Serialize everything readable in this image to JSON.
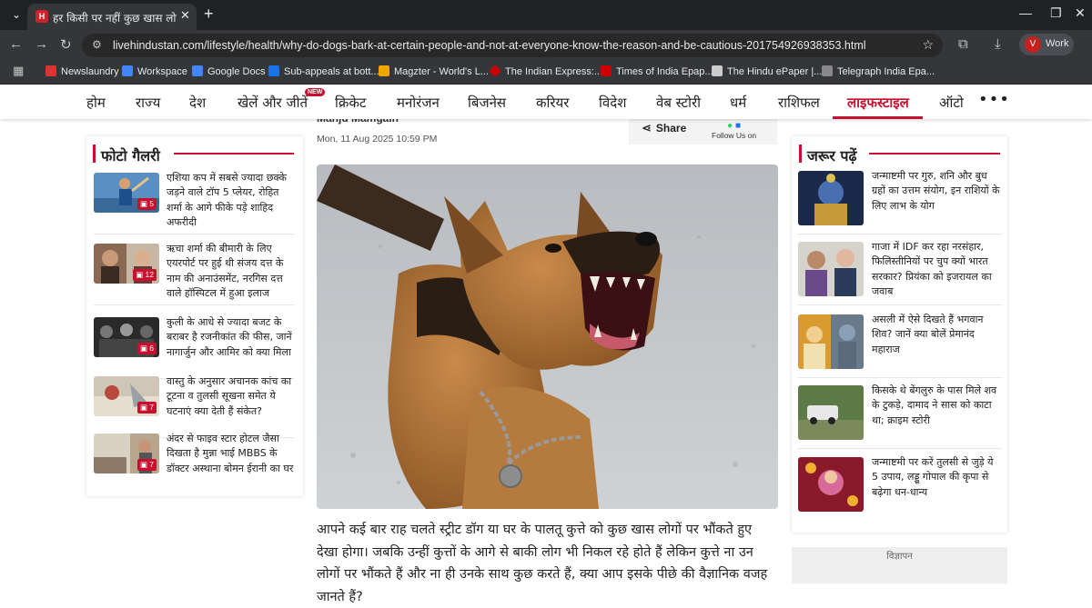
{
  "browser": {
    "tab_title": "हर किसी पर नहीं कुछ खास लोगों पर",
    "tab_favicon_letter": "H",
    "url": "livehindustan.com/lifestyle/health/why-do-dogs-bark-at-certain-people-and-not-at-everyone-know-the-reason-and-be-cautious-201754926938353.html",
    "profile_initial": "V",
    "profile_label": "Work",
    "bookmarks": [
      {
        "label": "Newslaundry",
        "color": "#d33"
      },
      {
        "label": "Workspace",
        "color": "#4285f4"
      },
      {
        "label": "Google Docs",
        "color": "#4285f4"
      },
      {
        "label": "Sub-appeals at bott...",
        "color": "#1a73e8"
      },
      {
        "label": "Magzter - World's L...",
        "color": "#f0a500"
      },
      {
        "label": "The Indian Express:...",
        "color": "#c00"
      },
      {
        "label": "Times of India Epap...",
        "color": "#c00"
      },
      {
        "label": "The Hindu ePaper |...",
        "color": "#ccc"
      },
      {
        "label": "Telegraph India Epa...",
        "color": "#888"
      }
    ]
  },
  "nav": {
    "items": [
      "होम",
      "राज्य",
      "देश",
      "खेलें और जीतें",
      "क्रिकेट",
      "मनोरंजन",
      "बिजनेस",
      "करियर",
      "विदेश",
      "वेब स्टोरी",
      "धर्म",
      "राशिफल",
      "लाइफस्टाइल",
      "ऑटो"
    ],
    "badge": "NEW",
    "more": "•••"
  },
  "article": {
    "author": "Manju Mamgain",
    "date": "Mon, 11 Aug 2025 10:59 PM",
    "share_label": "Share",
    "follow_label": "Follow Us on",
    "body": "आपने कई बार राह चलते स्ट्रीट डॉग या घर के पालतू कुत्ते को कुछ खास लोगों पर भौंकते हुए देखा होगा। जबकि उन्हीं कुत्तों के आगे से बाकी लोग भी निकल रहे होते हैं लेकिन कुत्ते ना उन लोगों पर भौंकते हैं और ना ही उनके साथ कुछ करते हैं, क्या आप इसके पीछे की वैज्ञानिक वजह जानते हैं?"
  },
  "gallery": {
    "heading": "फोटो गैलरी",
    "items": [
      {
        "text": "एशिया कप में सबसे ज्यादा छक्के जड़ने वाले टॉप 5 प्लेयर, रोहित शर्मा के आगे फीके पड़े शाहिद अफरीदी",
        "count": "5"
      },
      {
        "text": "ऋचा शर्मा की बीमारी के लिए एयरपोर्ट पर हुई थी संजय दत्त के नाम की अनाउंसमेंट, नरगिस दत्त वाले हॉस्पिटल में हुआ इलाज",
        "count": "12"
      },
      {
        "text": "कुली के आधे से ज्यादा बजट के बराबर है रजनीकांत की फीस, जानें नागार्जुन और आमिर को क्या मिला",
        "count": "6"
      },
      {
        "text": "वास्तु के अनुसार अचानक कांच का टूटना व तुलसी सूखना समेत ये घटनाएं क्या देती हैं संकेत?",
        "count": "7"
      },
      {
        "text": "अंदर से फाइव स्टार होटल जैसा दिखता है मुन्ना भाई MBBS के डॉक्टर अस्थाना बोमन ईरानी का घर",
        "count": "7"
      }
    ]
  },
  "must_read": {
    "heading": "जरूर पढ़ें",
    "items": [
      {
        "text": "जन्माष्टमी पर गुरु, शनि और बुध ग्रहों का उत्तम संयोग, इन राशियों के लिए लाभ के योग"
      },
      {
        "text": "गाजा में IDF कर रहा नरसंहार, फिलिस्तीनियों पर चुप क्यों भारत सरकार? प्रियंका को इजरायल का जवाब"
      },
      {
        "text": "असली में ऐसे दिखते हैं भगवान शिव? जानें क्या बोलें प्रेमानंद महाराज"
      },
      {
        "text": "किसके थे बेंगलुरु के पास मिले शव के टुकड़े, दामाद ने सास को काटा था; क्राइम स्टोरी"
      },
      {
        "text": "जन्माष्टमी पर करें तुलसी से जुड़े ये 5 उपाय, लड्डू गोपाल की कृपा से बढ़ेगा धन-धान्य"
      }
    ]
  },
  "ad_label": "विज्ञापन",
  "colors": {
    "accent": "#c8102e",
    "chrome_dark": "#202124",
    "chrome_toolbar": "#35363a"
  }
}
